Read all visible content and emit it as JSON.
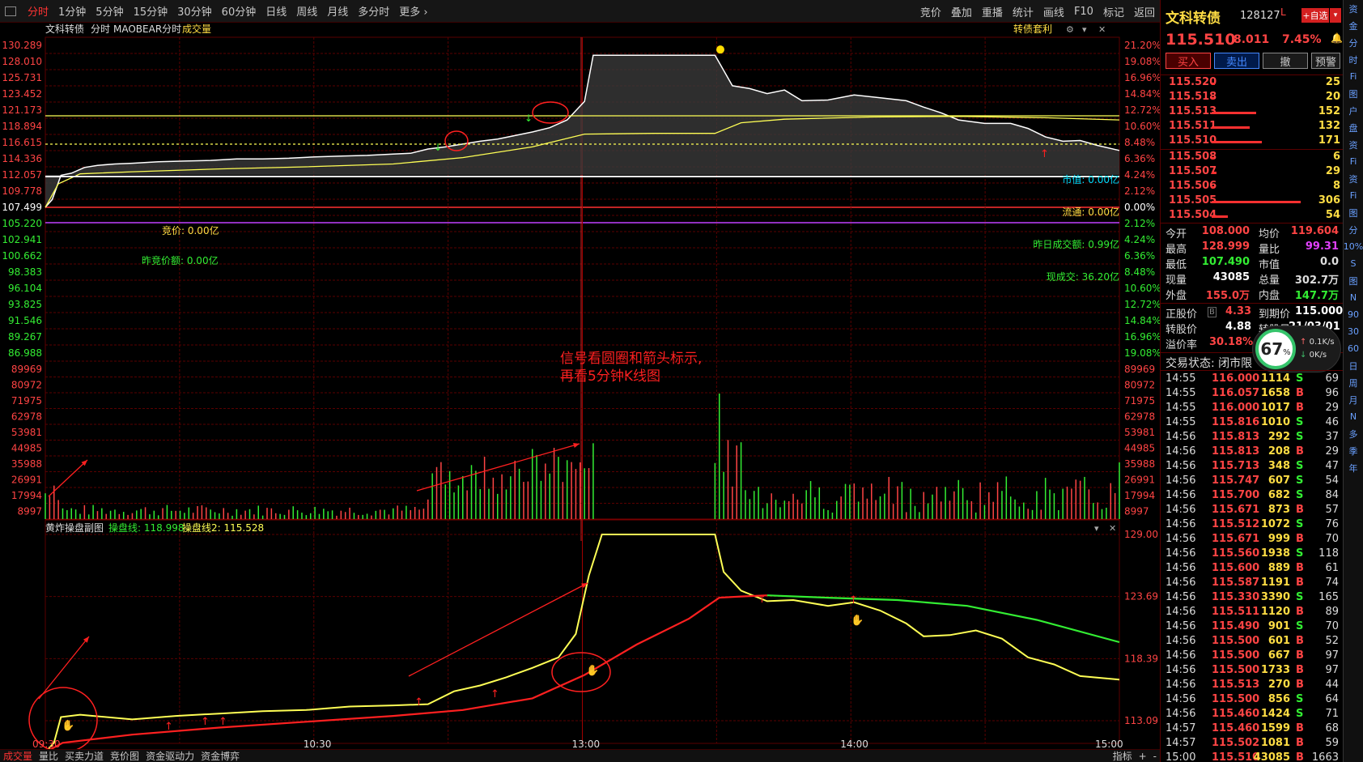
{
  "app": {
    "periods": [
      "分时",
      "1分钟",
      "5分钟",
      "15分钟",
      "30分钟",
      "60分钟",
      "日线",
      "周线",
      "月线",
      "多分时",
      "更多"
    ],
    "active_period": "分时",
    "tools": [
      "竞价",
      "叠加",
      "重播",
      "统计",
      "画线",
      "F10",
      "标记",
      "返回"
    ]
  },
  "chart_header": {
    "name": "文科转债",
    "mode": "分时",
    "indicator": "MAOBEAR分时",
    "volume_label": "成交量",
    "right_label": "转债套利"
  },
  "price_axis": {
    "left": [
      "130.289",
      "128.010",
      "125.731",
      "123.452",
      "121.173",
      "118.894",
      "116.615",
      "114.336",
      "112.057",
      "109.778",
      "107.499",
      "105.220",
      "102.941",
      "100.662",
      "98.383",
      "96.104",
      "93.825",
      "91.546",
      "89.267",
      "86.988"
    ],
    "right": [
      "21.20%",
      "19.08%",
      "16.96%",
      "14.84%",
      "12.72%",
      "10.60%",
      "8.48%",
      "6.36%",
      "4.24%",
      "2.12%",
      "0.00%",
      "2.12%",
      "4.24%",
      "6.36%",
      "8.48%",
      "10.60%",
      "12.72%",
      "14.84%",
      "16.96%",
      "19.08%"
    ]
  },
  "volume_axis": [
    "89969",
    "80972",
    "71975",
    "62978",
    "53981",
    "44985",
    "35988",
    "26991",
    "17994",
    "8997"
  ],
  "sub_axis": [
    "129.00",
    "123.69",
    "118.39",
    "113.09"
  ],
  "time_axis": [
    "09:30",
    "10:30",
    "13:00",
    "14:00",
    "15:00"
  ],
  "overlays": {
    "market_value": "市值: 0.00亿",
    "circulating": "流通: 0.00亿",
    "bid_price": "竞价: 0.00亿",
    "prev_bid_amount": "昨竞价额: 0.00亿",
    "prev_turnover": "昨日成交额: 0.99亿",
    "current_turnover": "现成交: 36.20亿"
  },
  "annotation": {
    "line1": "信号看圆圈和箭头标示,",
    "line2": "再看5分钟K线图"
  },
  "sub_chart": {
    "title": "黄炸操盘副图",
    "line1": "操盘线: 118.998",
    "line2": "操盘线2: 115.528"
  },
  "bottom_tabs": [
    "成交量",
    "量比",
    "买卖力道",
    "竞价图",
    "资金驱动力",
    "资金博弈"
  ],
  "bottom_right": "指标",
  "quote": {
    "name": "文科转债",
    "code": "128127",
    "price": "115.510",
    "change": "8.011",
    "change_pct": "7.45%",
    "add_fav": "+自选",
    "buttons": [
      "买入",
      "卖出",
      "撤",
      "预警"
    ]
  },
  "orderbook": {
    "asks": [
      {
        "price": "115.520",
        "vol": "25",
        "share": 0.04
      },
      {
        "price": "115.518",
        "vol": "20",
        "share": 0.03
      },
      {
        "price": "115.513",
        "vol": "152",
        "share": 0.5
      },
      {
        "price": "115.511",
        "vol": "132",
        "share": 0.43
      },
      {
        "price": "115.510",
        "vol": "171",
        "share": 0.56
      }
    ],
    "bids": [
      {
        "price": "115.508",
        "vol": "6",
        "share": 0.01
      },
      {
        "price": "115.507",
        "vol": "29",
        "share": 0.05
      },
      {
        "price": "115.506",
        "vol": "8",
        "share": 0.02
      },
      {
        "price": "115.505",
        "vol": "306",
        "share": 1.0
      },
      {
        "price": "115.504",
        "vol": "54",
        "share": 0.18
      }
    ]
  },
  "stats": [
    {
      "l1": "今开",
      "v1": "108.000",
      "c1": "#ff4444",
      "l2": "均价",
      "v2": "119.604",
      "c2": "#ff4444"
    },
    {
      "l1": "最高",
      "v1": "128.999",
      "c1": "#ff4444",
      "l2": "量比",
      "v2": "99.31",
      "c2": "#e040fb"
    },
    {
      "l1": "最低",
      "v1": "107.490",
      "c1": "#33ee33",
      "l2": "市值",
      "v2": "0.0",
      "c2": "#dddddd"
    },
    {
      "l1": "现量",
      "v1": "43085",
      "c1": "#ffffff",
      "l2": "总量",
      "v2": "302.7万",
      "c2": "#dddddd"
    },
    {
      "l1": "外盘",
      "v1": "155.0万",
      "c1": "#ff4444",
      "l2": "内盘",
      "v2": "147.7万",
      "c2": "#33ee33"
    }
  ],
  "bond": {
    "stock_price_label": "正股价",
    "stock_price": "4.33",
    "maturity_label": "到期价",
    "maturity": "115.000",
    "conv_price_label": "转股价",
    "conv_price": "4.88",
    "conv_date_label": "转股日",
    "conv_date": "21/03/01",
    "premium_label": "溢价率",
    "premium": "30.18%",
    "gauge": "67",
    "gauge_unit": "%",
    "speed_up": "0.1K/s",
    "speed_down": "0K/s"
  },
  "trade_status": "交易状态: 闭市限",
  "trades": [
    {
      "t": "14:55",
      "p": "116.000",
      "v": "1114",
      "s": "S",
      "n": "69"
    },
    {
      "t": "14:55",
      "p": "116.057",
      "v": "1658",
      "s": "B",
      "n": "96"
    },
    {
      "t": "14:55",
      "p": "116.000",
      "v": "1017",
      "s": "B",
      "n": "29"
    },
    {
      "t": "14:55",
      "p": "115.816",
      "v": "1010",
      "s": "S",
      "n": "46"
    },
    {
      "t": "14:56",
      "p": "115.813",
      "v": "292",
      "s": "S",
      "n": "37"
    },
    {
      "t": "14:56",
      "p": "115.813",
      "v": "208",
      "s": "B",
      "n": "29"
    },
    {
      "t": "14:56",
      "p": "115.713",
      "v": "348",
      "s": "S",
      "n": "47"
    },
    {
      "t": "14:56",
      "p": "115.747",
      "v": "607",
      "s": "S",
      "n": "54"
    },
    {
      "t": "14:56",
      "p": "115.700",
      "v": "682",
      "s": "S",
      "n": "84"
    },
    {
      "t": "14:56",
      "p": "115.671",
      "v": "873",
      "s": "B",
      "n": "57"
    },
    {
      "t": "14:56",
      "p": "115.512",
      "v": "1072",
      "s": "S",
      "n": "76"
    },
    {
      "t": "14:56",
      "p": "115.671",
      "v": "999",
      "s": "B",
      "n": "70"
    },
    {
      "t": "14:56",
      "p": "115.560",
      "v": "1938",
      "s": "S",
      "n": "118"
    },
    {
      "t": "14:56",
      "p": "115.600",
      "v": "889",
      "s": "B",
      "n": "61"
    },
    {
      "t": "14:56",
      "p": "115.587",
      "v": "1191",
      "s": "B",
      "n": "74"
    },
    {
      "t": "14:56",
      "p": "115.330",
      "v": "3390",
      "s": "S",
      "n": "165"
    },
    {
      "t": "14:56",
      "p": "115.511",
      "v": "1120",
      "s": "B",
      "n": "89"
    },
    {
      "t": "14:56",
      "p": "115.490",
      "v": "901",
      "s": "S",
      "n": "70"
    },
    {
      "t": "14:56",
      "p": "115.500",
      "v": "601",
      "s": "B",
      "n": "52"
    },
    {
      "t": "14:56",
      "p": "115.500",
      "v": "667",
      "s": "B",
      "n": "97"
    },
    {
      "t": "14:56",
      "p": "115.500",
      "v": "1733",
      "s": "B",
      "n": "97"
    },
    {
      "t": "14:56",
      "p": "115.513",
      "v": "270",
      "s": "B",
      "n": "44"
    },
    {
      "t": "14:56",
      "p": "115.500",
      "v": "856",
      "s": "S",
      "n": "64"
    },
    {
      "t": "14:56",
      "p": "115.460",
      "v": "1424",
      "s": "S",
      "n": "71"
    },
    {
      "t": "14:57",
      "p": "115.460",
      "v": "1599",
      "s": "B",
      "n": "68"
    },
    {
      "t": "14:57",
      "p": "115.502",
      "v": "1081",
      "s": "B",
      "n": "59"
    },
    {
      "t": "15:00",
      "p": "115.510",
      "v": "43085",
      "s": "B",
      "n": "1663"
    }
  ],
  "strip": [
    "资",
    "金",
    "分",
    "时",
    "Fi",
    "图",
    "户",
    "盘",
    "资",
    "Fi",
    "资",
    "Fi",
    "图",
    "分",
    "10%",
    "S",
    "图",
    "N",
    "90",
    "30",
    "60",
    "日",
    "周",
    "月",
    "N",
    "多",
    "季",
    "年"
  ],
  "colors": {
    "up": "#ff4444",
    "down": "#33ee33",
    "price_line": "#ffffff",
    "avg_line": "#ffff55",
    "grid": "#5a0000"
  }
}
